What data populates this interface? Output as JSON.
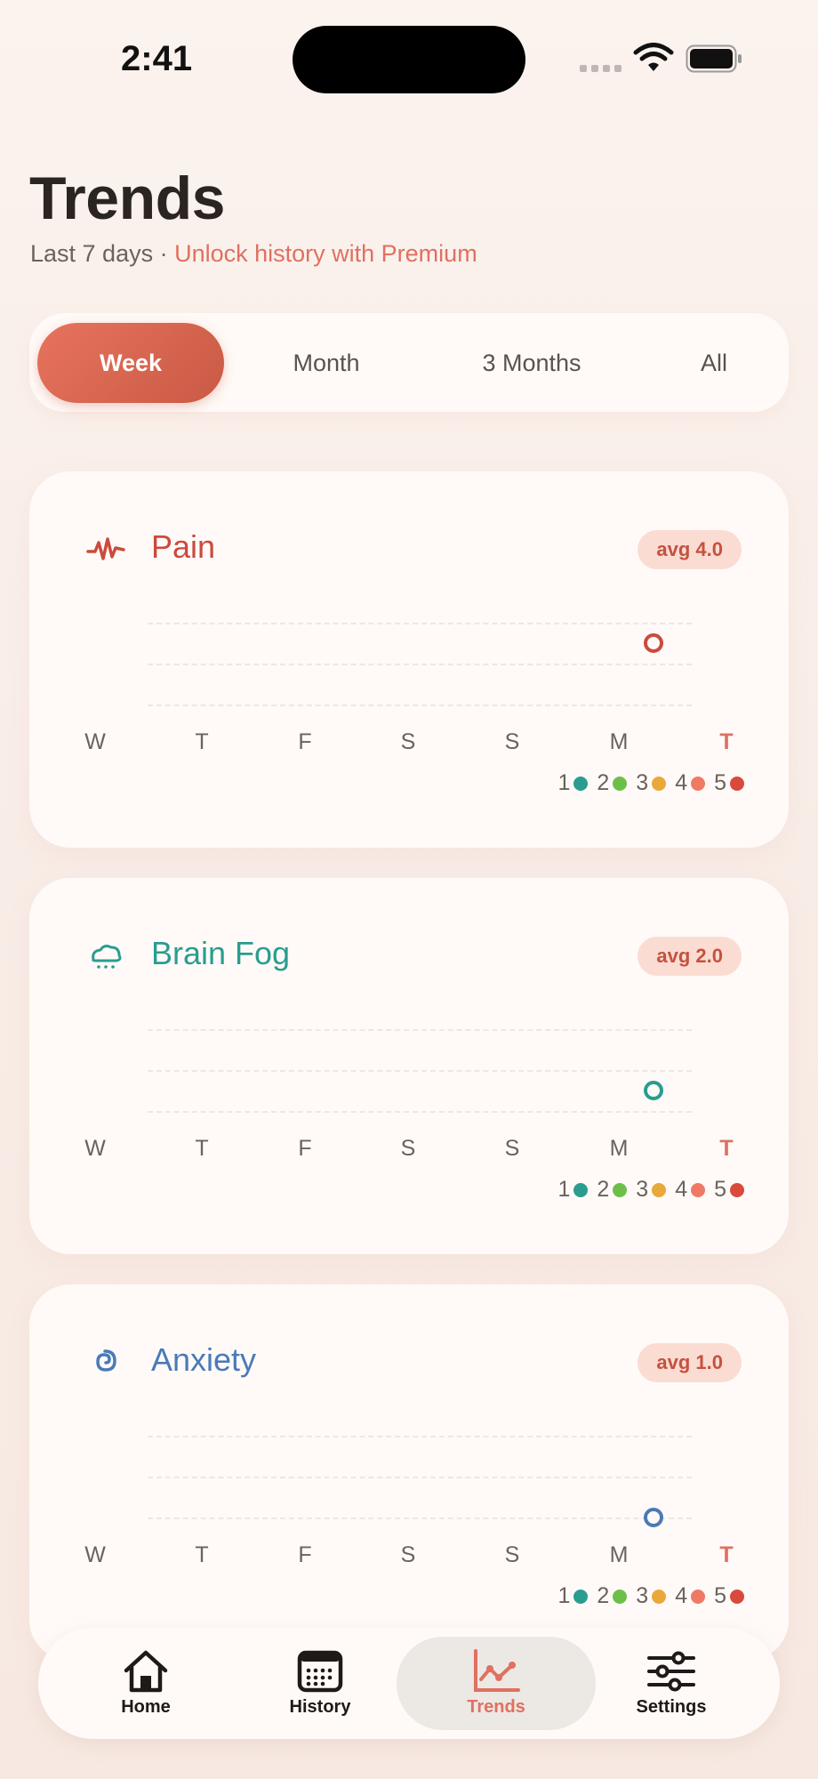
{
  "status_bar": {
    "time": "2:41"
  },
  "header": {
    "title": "Trends",
    "subtitle_prefix": "Last 7 days · ",
    "subtitle_link": "Unlock history with Premium"
  },
  "range_tabs": [
    {
      "label": "Week",
      "active": true
    },
    {
      "label": "Month",
      "active": false
    },
    {
      "label": "3 Months",
      "active": false
    },
    {
      "label": "All",
      "active": false
    }
  ],
  "days": [
    "W",
    "T",
    "F",
    "S",
    "S",
    "M",
    "T"
  ],
  "legend": [
    {
      "label": "1",
      "color": "#2a9d8f"
    },
    {
      "label": "2",
      "color": "#6cc04a"
    },
    {
      "label": "3",
      "color": "#e8a93a"
    },
    {
      "label": "4",
      "color": "#ee7a65"
    },
    {
      "label": "5",
      "color": "#d84a3c"
    }
  ],
  "cards": [
    {
      "title": "Pain",
      "avg": "avg 4.0",
      "color": "#cc4a3c",
      "icon": "pulse-icon",
      "today_value": 4
    },
    {
      "title": "Brain Fog",
      "avg": "avg 2.0",
      "color": "#2a9d8f",
      "icon": "cloud-icon",
      "today_value": 2
    },
    {
      "title": "Anxiety",
      "avg": "avg 1.0",
      "color": "#4a7ab8",
      "icon": "spiral-icon",
      "today_value": 1
    }
  ],
  "nav": [
    {
      "label": "Home",
      "icon": "home-icon",
      "active": false
    },
    {
      "label": "History",
      "icon": "calendar-icon",
      "active": false
    },
    {
      "label": "Trends",
      "icon": "chart-icon",
      "active": true
    },
    {
      "label": "Settings",
      "icon": "sliders-icon",
      "active": false
    }
  ]
}
